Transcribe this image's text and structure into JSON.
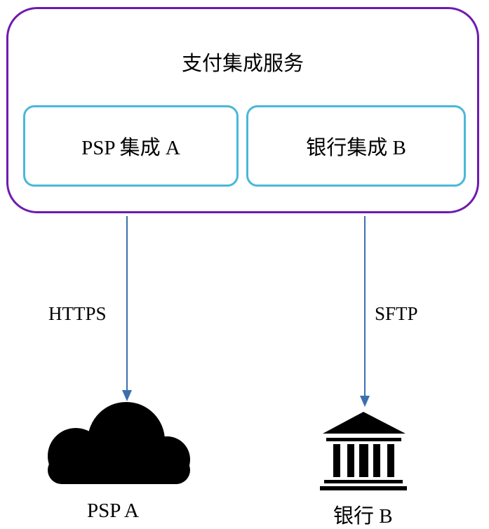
{
  "outer": {
    "title": "支付集成服务"
  },
  "integrations": {
    "psp": "PSP 集成 A",
    "bank": "银行集成 B"
  },
  "connections": {
    "psp_protocol": "HTTPS",
    "bank_protocol": "SFTP"
  },
  "endpoints": {
    "psp": {
      "label": "PSP A",
      "icon": "cloud-icon"
    },
    "bank": {
      "label": "银行 B",
      "icon": "bank-icon"
    }
  },
  "colors": {
    "outer_border": "#6f1ab0",
    "inner_border": "#4ab8d8",
    "arrow": "#3d6fae",
    "icon": "#000000"
  }
}
